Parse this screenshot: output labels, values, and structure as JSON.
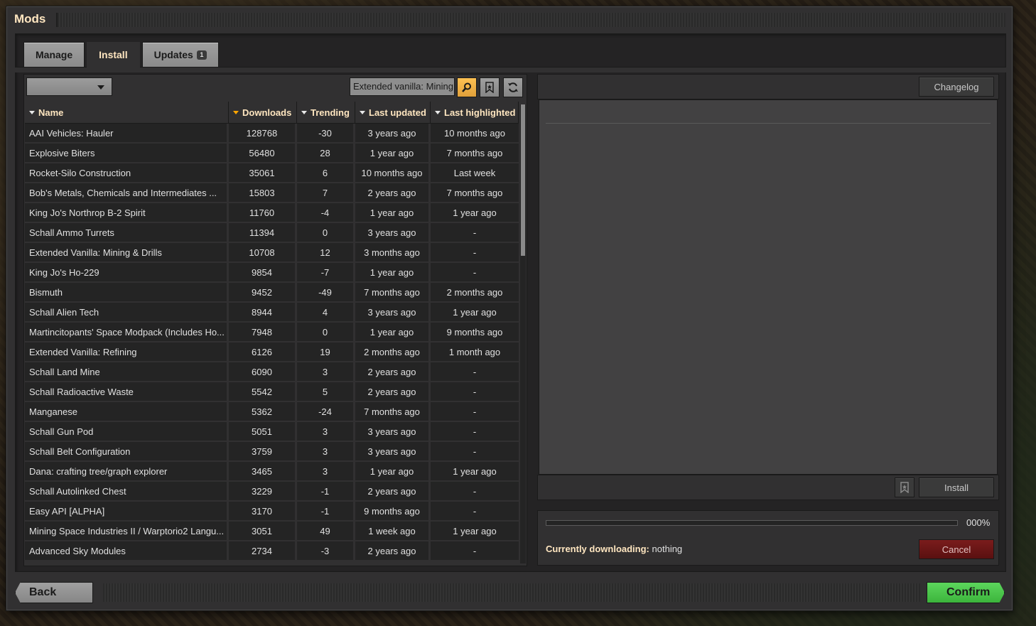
{
  "window": {
    "title": "Mods"
  },
  "tabs": [
    {
      "label": "Manage",
      "active": false
    },
    {
      "label": "Install",
      "active": true
    },
    {
      "label": "Updates",
      "badge": "1",
      "active": false
    }
  ],
  "filter": {
    "dropdown_value": "",
    "search_value": "Extended vanilla: Mining"
  },
  "table": {
    "headers": {
      "name": "Name",
      "downloads": "Downloads",
      "trending": "Trending",
      "last_updated": "Last updated",
      "last_highlighted": "Last highlighted"
    },
    "rows": [
      {
        "name": "AAI Vehicles: Hauler",
        "downloads": "128768",
        "trending": "-30",
        "last_updated": "3 years ago",
        "last_highlighted": "10 months ago"
      },
      {
        "name": "Explosive Biters",
        "downloads": "56480",
        "trending": "28",
        "last_updated": "1 year ago",
        "last_highlighted": "7 months ago"
      },
      {
        "name": "Rocket-Silo Construction",
        "downloads": "35061",
        "trending": "6",
        "last_updated": "10 months ago",
        "last_highlighted": "Last week"
      },
      {
        "name": "Bob's Metals, Chemicals and Intermediates ...",
        "downloads": "15803",
        "trending": "7",
        "last_updated": "2 years ago",
        "last_highlighted": "7 months ago"
      },
      {
        "name": "King Jo's Northrop B-2 Spirit",
        "downloads": "11760",
        "trending": "-4",
        "last_updated": "1 year ago",
        "last_highlighted": "1 year ago"
      },
      {
        "name": "Schall Ammo Turrets",
        "downloads": "11394",
        "trending": "0",
        "last_updated": "3 years ago",
        "last_highlighted": "-"
      },
      {
        "name": "Extended Vanilla: Mining & Drills",
        "downloads": "10708",
        "trending": "12",
        "last_updated": "3 months ago",
        "last_highlighted": "-"
      },
      {
        "name": "King Jo's Ho-229",
        "downloads": "9854",
        "trending": "-7",
        "last_updated": "1 year ago",
        "last_highlighted": "-"
      },
      {
        "name": "Bismuth",
        "downloads": "9452",
        "trending": "-49",
        "last_updated": "7 months ago",
        "last_highlighted": "2 months ago"
      },
      {
        "name": "Schall Alien Tech",
        "downloads": "8944",
        "trending": "4",
        "last_updated": "3 years ago",
        "last_highlighted": "1 year ago"
      },
      {
        "name": "Martincitopants' Space Modpack (Includes Ho...",
        "downloads": "7948",
        "trending": "0",
        "last_updated": "1 year ago",
        "last_highlighted": "9 months ago"
      },
      {
        "name": "Extended Vanilla: Refining",
        "downloads": "6126",
        "trending": "19",
        "last_updated": "2 months ago",
        "last_highlighted": "1 month ago"
      },
      {
        "name": "Schall Land Mine",
        "downloads": "6090",
        "trending": "3",
        "last_updated": "2 years ago",
        "last_highlighted": "-"
      },
      {
        "name": "Schall Radioactive Waste",
        "downloads": "5542",
        "trending": "5",
        "last_updated": "2 years ago",
        "last_highlighted": "-"
      },
      {
        "name": "Manganese",
        "downloads": "5362",
        "trending": "-24",
        "last_updated": "7 months ago",
        "last_highlighted": "-"
      },
      {
        "name": "Schall Gun Pod",
        "downloads": "5051",
        "trending": "3",
        "last_updated": "3 years ago",
        "last_highlighted": "-"
      },
      {
        "name": "Schall Belt Configuration",
        "downloads": "3759",
        "trending": "3",
        "last_updated": "3 years ago",
        "last_highlighted": "-"
      },
      {
        "name": "Dana: crafting tree/graph explorer",
        "downloads": "3465",
        "trending": "3",
        "last_updated": "1 year ago",
        "last_highlighted": "1 year ago"
      },
      {
        "name": "Schall Autolinked Chest",
        "downloads": "3229",
        "trending": "-1",
        "last_updated": "2 years ago",
        "last_highlighted": "-"
      },
      {
        "name": "Easy API [ALPHA]",
        "downloads": "3170",
        "trending": "-1",
        "last_updated": "9 months ago",
        "last_highlighted": "-"
      },
      {
        "name": "Mining Space Industries II / Warptorio2 Langu...",
        "downloads": "3051",
        "trending": "49",
        "last_updated": "1 week ago",
        "last_highlighted": "1 year ago"
      },
      {
        "name": "Advanced Sky Modules",
        "downloads": "2734",
        "trending": "-3",
        "last_updated": "2 years ago",
        "last_highlighted": "-"
      }
    ]
  },
  "details": {
    "changelog_label": "Changelog",
    "install_label": "Install"
  },
  "download": {
    "progress_percent": 0,
    "progress_text": "000%",
    "status_label": "Currently downloading:",
    "status_value": "nothing",
    "cancel_label": "Cancel"
  },
  "footer": {
    "back_label": "Back",
    "confirm_label": "Confirm"
  },
  "colors": {
    "accent": "#ffa500",
    "confirm": "#5cd65c",
    "cancel": "#7a1c1c",
    "heading": "#ffe6c0"
  }
}
